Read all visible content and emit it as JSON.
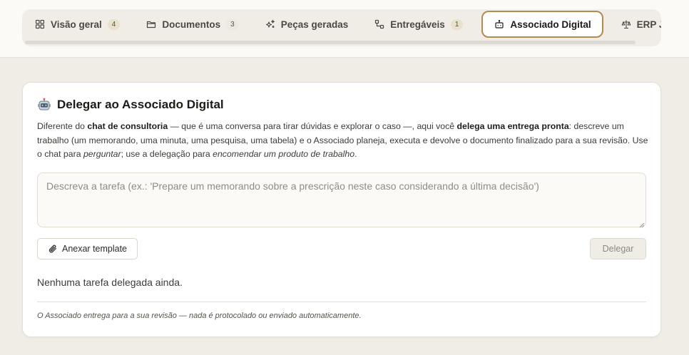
{
  "tabs": [
    {
      "label": "Visão geral",
      "icon": "grid-icon",
      "badge": "4"
    },
    {
      "label": "Documentos",
      "icon": "folder-icon",
      "badge": "3"
    },
    {
      "label": "Peças geradas",
      "icon": "sparkles-icon"
    },
    {
      "label": "Entregáveis",
      "icon": "workflow-icon",
      "badge": "1"
    },
    {
      "label": "Associado Digital",
      "icon": "bot-icon",
      "active": true
    },
    {
      "label": "ERP Jurídi",
      "icon": "scale-icon"
    }
  ],
  "card": {
    "icon": "robot-icon",
    "title": "Delegar ao Associado Digital",
    "desc": {
      "p1": "Diferente do ",
      "b1": "chat de consultoria",
      "p2": " — que é uma conversa para tirar dúvidas e explorar o caso —, aqui você ",
      "b2": "delega uma entrega pronta",
      "p3": ": descreve um trabalho (um memorando, uma minuta, uma pesquisa, uma tabela) e o Associado planeja, executa e devolve o documento finalizado para a sua revisão. Use o chat para ",
      "i1": "perguntar",
      "p4": "; use a delegação para ",
      "i2": "encomendar um produto de trabalho",
      "p5": "."
    },
    "task_placeholder": "Descreva a tarefa (ex.: 'Prepare um memorando sobre a prescrição neste caso considerando a última decisão')",
    "task_value": "",
    "attach_label": "Anexar template",
    "attach_icon": "paperclip-icon",
    "delegate_label": "Delegar",
    "empty_text": "Nenhuma tarefa delegada ainda.",
    "footnote": "O Associado entrega para a sua revisão — nada é protocolado ou enviado automaticamente."
  },
  "colors": {
    "background": "#efede6",
    "active_tab_border": "#b48b4f",
    "badge_bg": "#e8e1cc"
  }
}
